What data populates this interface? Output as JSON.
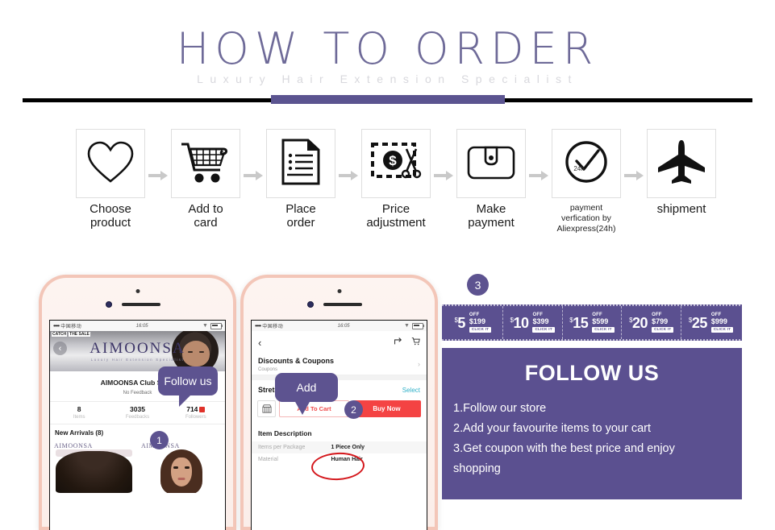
{
  "header": {
    "title": "HOW TO ORDER",
    "subtitle": "Luxury Hair Extension Specialist"
  },
  "steps": [
    {
      "icon": "heart-icon",
      "label": "Choose\nproduct",
      "small": false
    },
    {
      "icon": "cart-icon",
      "label": "Add to\ncard",
      "small": false
    },
    {
      "icon": "document-icon",
      "label": "Place\norder",
      "small": false
    },
    {
      "icon": "price-cut-icon",
      "label": "Price\nadjustment",
      "small": false
    },
    {
      "icon": "wallet-icon",
      "label": "Make\npayment",
      "small": false
    },
    {
      "icon": "clock-check-icon",
      "label": "payment\nverfication by\nAliexpress(24h)",
      "small": true
    },
    {
      "icon": "airplane-icon",
      "label": "shipment",
      "small": false
    }
  ],
  "phone_a": {
    "status": {
      "carrier": "中国移动",
      "time": "16:05",
      "dots": "••••"
    },
    "banner": {
      "brand": "AIMOONSA",
      "brand_sub": "Luxury Hair Extension Specialist",
      "tag1": "CATCH",
      "tag2": "THE SALE"
    },
    "store_name": "AIMOONSA Club Store",
    "feedback": "No Feedback",
    "stats": [
      {
        "num": "8",
        "label": "Items"
      },
      {
        "num": "3035",
        "label": "Feedbacks"
      },
      {
        "num": "714",
        "label": "Followers",
        "has_badge": true
      }
    ],
    "arrivals": "New Arrivals (8)",
    "cards": [
      {
        "watermark": "AIMOONSA"
      },
      {
        "watermark": "AIMOONSA"
      }
    ],
    "bubble": "Follow us",
    "badge": "1"
  },
  "phone_b": {
    "status": {
      "carrier": "中国移动",
      "time": "16:05",
      "dots": "••••"
    },
    "discounts_title": "Discounts & Coupons",
    "discounts_sub": "Coupons",
    "length_title": "Stretched Length",
    "select_label": "Select",
    "add_to_cart": "Add To Cart",
    "buy_now": "Buy Now",
    "item_description": "Item Description",
    "spec_rows": [
      {
        "key": "Items per Package",
        "value": "1 Piece Only"
      },
      {
        "key": "Material",
        "value": "Human Hair"
      }
    ],
    "bubble": "Add",
    "badge": "2"
  },
  "right": {
    "badge": "3",
    "coupons": [
      {
        "amount": "5",
        "currency": "$",
        "off": "OFF",
        "min": "$199",
        "click": "CLICK IT"
      },
      {
        "amount": "10",
        "currency": "$",
        "off": "OFF",
        "min": "$399",
        "click": "CLICK IT"
      },
      {
        "amount": "15",
        "currency": "$",
        "off": "OFF",
        "min": "$599",
        "click": "CLICK IT"
      },
      {
        "amount": "20",
        "currency": "$",
        "off": "OFF",
        "min": "$799",
        "click": "CLICK IT"
      },
      {
        "amount": "25",
        "currency": "$",
        "off": "OFF",
        "min": "$999",
        "click": "CLICK IT"
      }
    ],
    "follow_title": "FOLLOW US",
    "follow_lines": [
      "1.Follow our store",
      "2.Add your favourite items to your cart",
      "3.Get coupon with the best price and enjoy",
      "shopping"
    ]
  },
  "colors": {
    "accent_purple": "#5b5090",
    "title_purple": "#6e6a98",
    "subtitle_gray": "#d8d8dd",
    "rule_black": "#000000",
    "buy_now_red": "#f44343",
    "add_to_cart_red": "#f04a4a",
    "select_teal": "#2fb0c8",
    "phone_frame_pink": "#f3c6b8"
  }
}
